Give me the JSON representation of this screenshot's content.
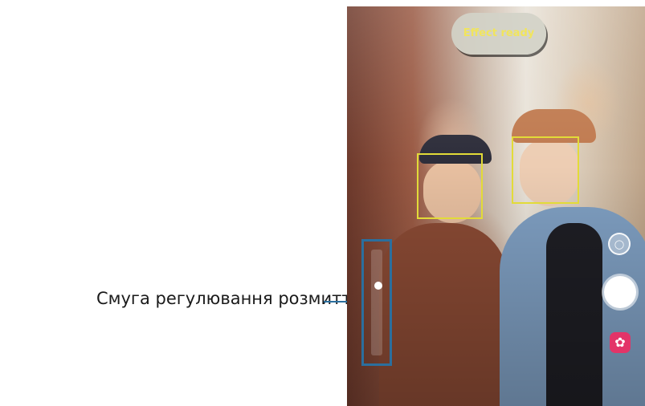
{
  "callout": {
    "label": "Смуга регулювання розмиття тла"
  },
  "camera": {
    "effect_button_label": "Effect ready",
    "icons": {
      "switch_camera": "camera-switch-icon",
      "shutter": "shutter-button",
      "effects": "flower-effects-icon"
    },
    "colors": {
      "face_box": "#e2db38",
      "callout_line": "#2b6f9e",
      "effects_button": "#e33468"
    }
  }
}
